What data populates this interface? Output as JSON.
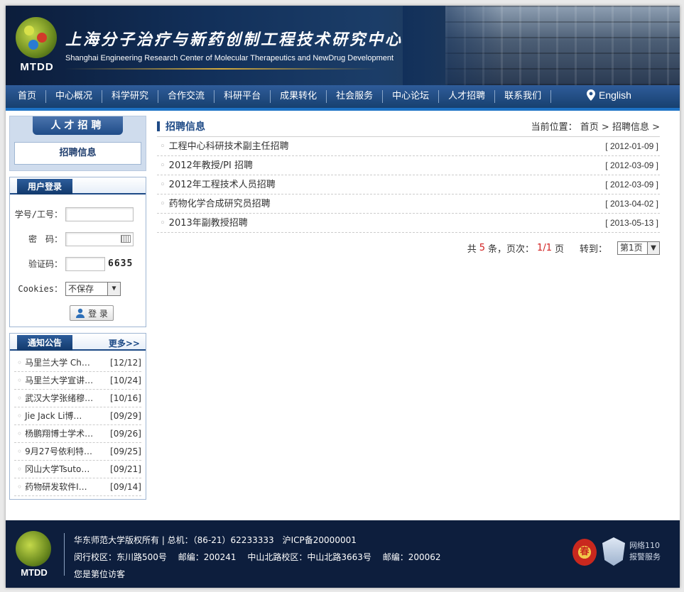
{
  "header": {
    "logo_text": "MTDD",
    "title": "上海分子治疗与新药创制工程技术研究中心",
    "subtitle": "Shanghai Engineering Research Center of  Molecular Therapeutics and NewDrug Development"
  },
  "nav": {
    "items": [
      "首页",
      "中心概况",
      "科学研究",
      "合作交流",
      "科研平台",
      "成果转化",
      "社会服务",
      "中心论坛",
      "人才招聘",
      "联系我们"
    ],
    "english": "English"
  },
  "sidebar": {
    "section_title": "人才招聘",
    "section_link": "招聘信息",
    "login": {
      "tab": "用户登录",
      "id_label": "学号/工号：",
      "pwd_label": "密　码：",
      "captcha_label": "验证码：",
      "captcha": "6635",
      "cookies_label": "Cookies：",
      "cookies_value": "不保存",
      "submit": "登 录"
    },
    "notice": {
      "tab": "通知公告",
      "more": "更多>>",
      "items": [
        {
          "title": "马里兰大学 Ch…",
          "date": "[12/12]"
        },
        {
          "title": "马里兰大学宣讲…",
          "date": "[10/24]"
        },
        {
          "title": "武汉大学张绪穆…",
          "date": "[10/16]"
        },
        {
          "title": "Jie Jack Li博…",
          "date": "[09/29]"
        },
        {
          "title": "杨鹏翔博士学术…",
          "date": "[09/26]"
        },
        {
          "title": "9月27号依利特…",
          "date": "[09/25]"
        },
        {
          "title": "冈山大学Tsuto…",
          "date": "[09/21]"
        },
        {
          "title": "药物研发软件I…",
          "date": "[09/14]"
        }
      ]
    }
  },
  "main": {
    "title": "招聘信息",
    "location": "当前位置： 首页 > 招聘信息 >",
    "jobs": [
      {
        "title": "工程中心科研技术副主任招聘",
        "date": "[ 2012-01-09 ]"
      },
      {
        "title": "2012年教授/PI 招聘",
        "date": "[ 2012-03-09 ]"
      },
      {
        "title": "2012年工程技术人员招聘",
        "date": "[ 2012-03-09 ]"
      },
      {
        "title": "药物化学合成研究员招聘",
        "date": "[ 2013-04-02 ]"
      },
      {
        "title": "2013年副教授招聘",
        "date": "[ 2013-05-13 ]"
      }
    ],
    "pager": {
      "pre": "共",
      "count": "5",
      "mid": "条，页次：",
      "page": "1/1",
      "post": "页",
      "goto": "转到：",
      "select": "第1页"
    }
  },
  "footer": {
    "logo_text": "MTDD",
    "line1": "华东师范大学版权所有 | 总机：（86-21）62233333　沪ICP备20000001",
    "line2": "闵行校区：东川路500号　 邮编：200241　 中山北路校区：中山北路3663号　 邮编：200062",
    "line3": "您是第位访客",
    "badge1": "春",
    "net110_line1": "网络110",
    "net110_line2": "报警服务"
  }
}
